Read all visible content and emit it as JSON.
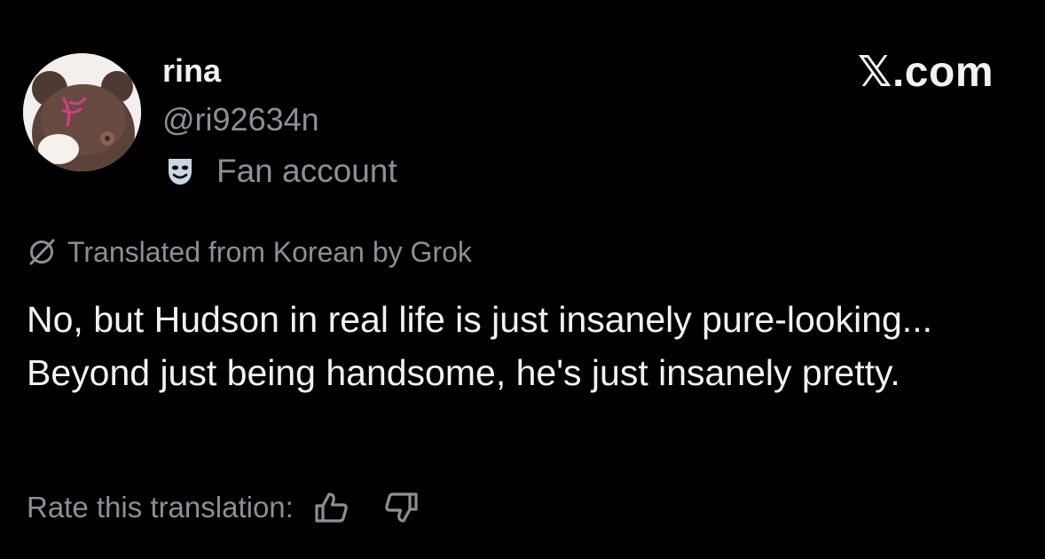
{
  "author": {
    "name": "rina",
    "handle": "@ri92634n",
    "label": "Fan account",
    "label_icon": "mask-icon",
    "avatar": "plush-bear-avatar"
  },
  "brand": {
    "text": "𝕏.com"
  },
  "translation": {
    "notice": "Translated from Korean by Grok",
    "notice_icon": "grok-icon",
    "rate_label": "Rate this translation:",
    "rate_up_icon": "thumbs-up-icon",
    "rate_down_icon": "thumbs-down-icon"
  },
  "post": {
    "text": "No, but Hudson in real life is just insanely pure-looking... Beyond just being handsome, he's just insanely pretty."
  },
  "colors": {
    "background": "#000000",
    "primary_text": "#f2f2f2",
    "secondary_text": "#8b9096",
    "mask_badge": "#c9d6e3"
  }
}
